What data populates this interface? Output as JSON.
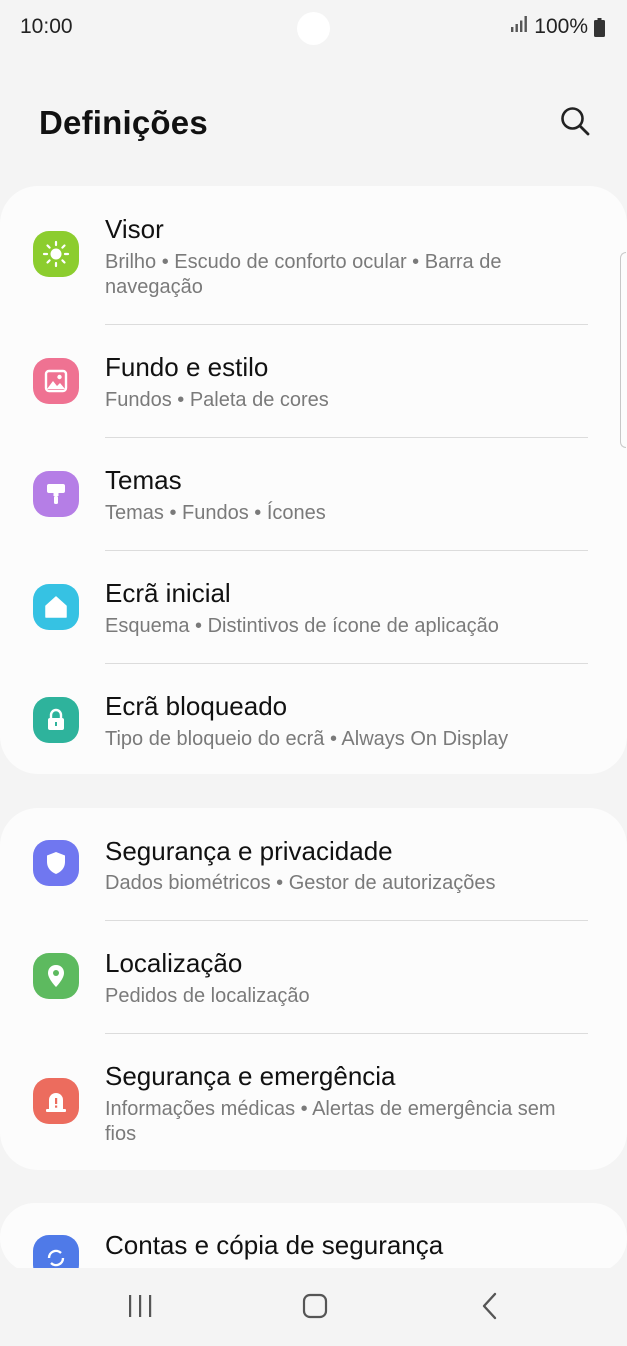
{
  "status_bar": {
    "time": "10:00",
    "battery": "100%",
    "icons": [
      "signal-icon",
      "battery-icon"
    ]
  },
  "header": {
    "title": "Definições",
    "search_icon": "search-icon"
  },
  "groups": [
    {
      "items": [
        {
          "title": "Visor",
          "subtitle": "Brilho  •  Escudo de conforto ocular  •  Barra de navegação",
          "icon": "sun-icon",
          "color": "#8ccd2e"
        },
        {
          "title": "Fundo e estilo",
          "subtitle": "Fundos  •  Paleta de cores",
          "icon": "image-icon",
          "color": "#ef7292"
        },
        {
          "title": "Temas",
          "subtitle": "Temas  •  Fundos  •  Ícones",
          "icon": "paint-brush-icon",
          "color": "#b57ee6"
        },
        {
          "title": "Ecrã inicial",
          "subtitle": "Esquema  •  Distintivos de ícone de aplicação",
          "icon": "home-icon",
          "color": "#36c2e3"
        },
        {
          "title": "Ecrã bloqueado",
          "subtitle": "Tipo de bloqueio do ecrã  •  Always On Display",
          "icon": "lock-icon",
          "color": "#2eb39c"
        }
      ]
    },
    {
      "items": [
        {
          "title": "Segurança e privacidade",
          "subtitle": "Dados biométricos  •  Gestor de autorizações",
          "icon": "shield-icon",
          "color": "#7077f0"
        },
        {
          "title": "Localização",
          "subtitle": "Pedidos de localização",
          "icon": "location-pin-icon",
          "color": "#5dba5f"
        },
        {
          "title": "Segurança e emergência",
          "subtitle": "Informações médicas  •  Alertas de emergência sem fios",
          "icon": "emergency-icon",
          "color": "#ec6c5e"
        }
      ]
    },
    {
      "items": [
        {
          "title": "Contas e cópia de segurança",
          "subtitle": "",
          "icon": "sync-icon",
          "color": "#4f7ae8"
        }
      ]
    }
  ],
  "nav_bar": {
    "icons": [
      "recent-apps-icon",
      "home-button-icon",
      "back-icon"
    ]
  }
}
